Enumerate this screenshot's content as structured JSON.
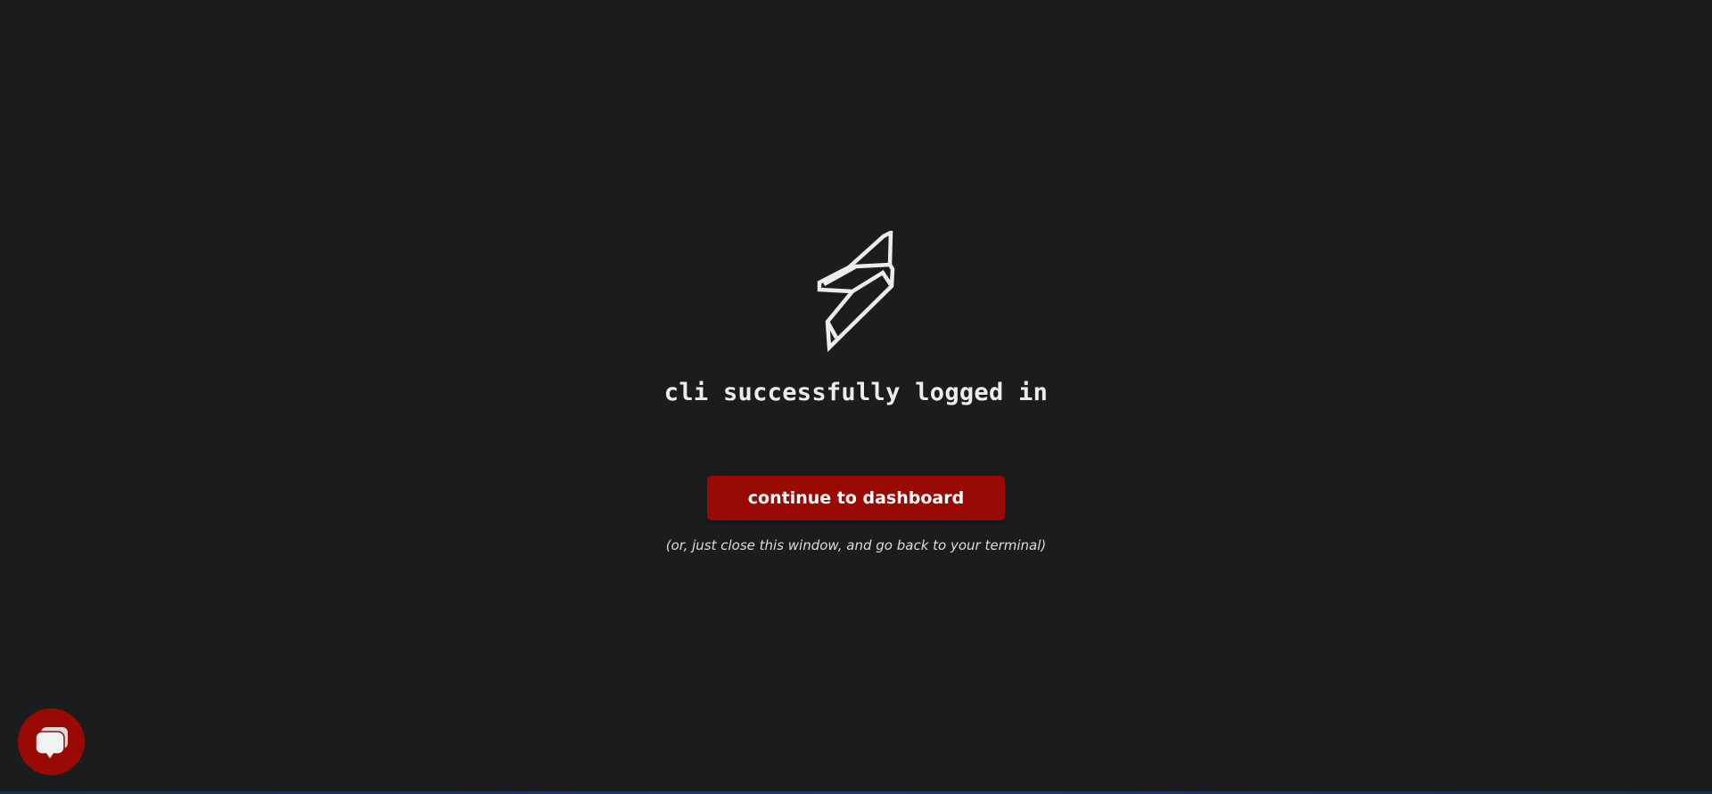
{
  "page": {
    "background": "#1b1c1e"
  },
  "logo": {
    "icon": "lightning-bolt-icon",
    "color": "#ececec"
  },
  "headline": {
    "text": "cli successfully logged in"
  },
  "cta": {
    "label": "continue to dashboard",
    "color": "#9a0a05"
  },
  "note": {
    "text": "(or, just close this window, and go back to your terminal)"
  },
  "chat_widget": {
    "icon": "chat-bubbles-icon",
    "color": "#9a0a05"
  }
}
